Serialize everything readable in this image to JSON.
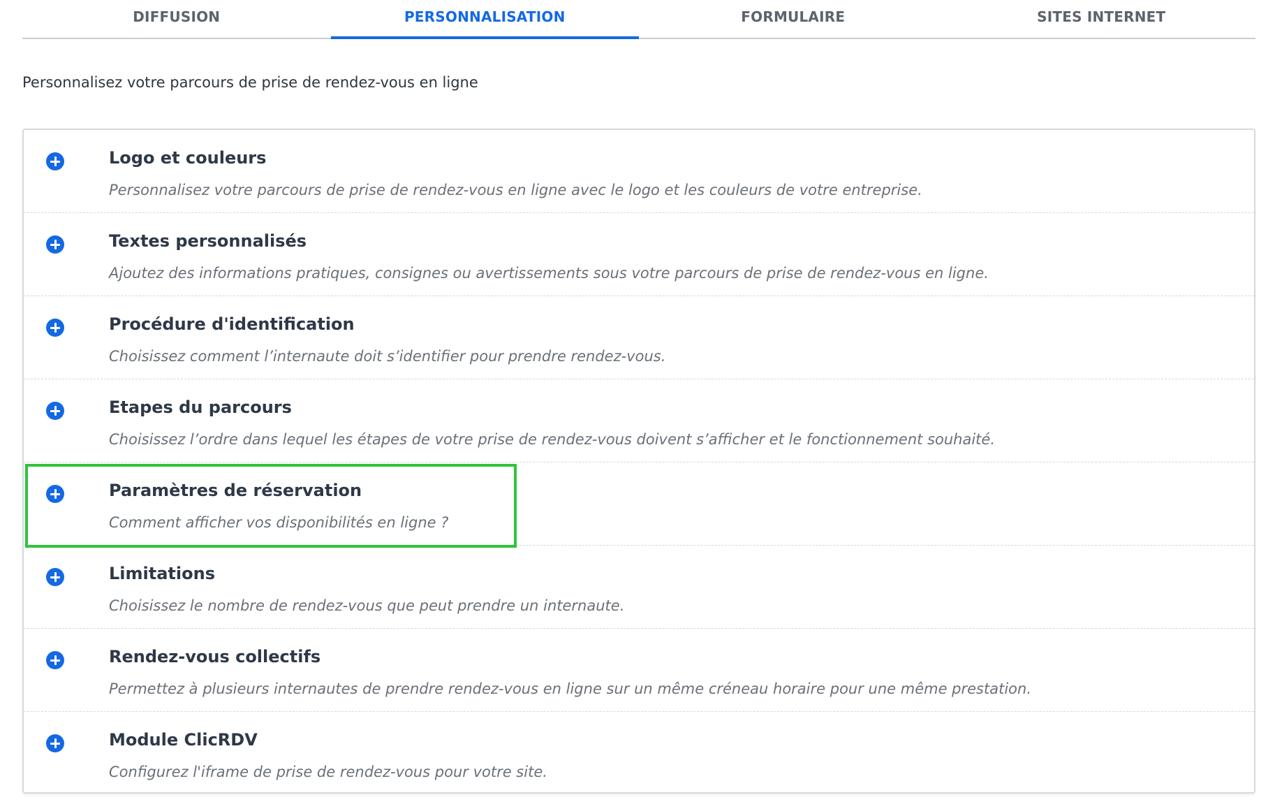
{
  "tabs": [
    {
      "label": "DIFFUSION",
      "active": false
    },
    {
      "label": "PERSONNALISATION",
      "active": true
    },
    {
      "label": "FORMULAIRE",
      "active": false
    },
    {
      "label": "SITES INTERNET",
      "active": false
    }
  ],
  "intro_text": "Personnalisez votre parcours de prise de rendez-vous en ligne",
  "sections": [
    {
      "title": "Logo et couleurs",
      "description": "Personnalisez votre parcours de prise de rendez-vous en ligne avec le logo et les couleurs de votre entreprise.",
      "icon": "plus-circle-icon"
    },
    {
      "title": "Textes personnalisés",
      "description": "Ajoutez des informations pratiques, consignes ou avertissements sous votre parcours de prise de rendez-vous en ligne.",
      "icon": "plus-circle-icon"
    },
    {
      "title": "Procédure d'identification",
      "description": "Choisissez comment l’internaute doit s’identifier pour prendre rendez-vous.",
      "icon": "plus-circle-icon"
    },
    {
      "title": "Etapes du parcours",
      "description": "Choisissez l’ordre dans lequel les étapes de votre prise de rendez-vous doivent s’afficher et le fonctionnement souhaité.",
      "icon": "plus-circle-icon"
    },
    {
      "title": "Paramètres de réservation",
      "description": "Comment afficher vos disponibilités en ligne ?",
      "icon": "plus-circle-icon",
      "highlighted": true
    },
    {
      "title": "Limitations",
      "description": "Choisissez le nombre de rendez-vous que peut prendre un internaute.",
      "icon": "plus-circle-icon"
    },
    {
      "title": "Rendez-vous collectifs",
      "description": "Permettez à plusieurs internautes de prendre rendez-vous en ligne sur un même créneau horaire pour une même prestation.",
      "icon": "plus-circle-icon"
    },
    {
      "title": "Module ClicRDV",
      "description": "Configurez l'iframe de prise de rendez-vous pour votre site.",
      "icon": "plus-circle-icon"
    }
  ],
  "colors": {
    "accent": "#1469e3",
    "highlight": "#2ec43a",
    "tab_inactive": "#5d636d"
  }
}
